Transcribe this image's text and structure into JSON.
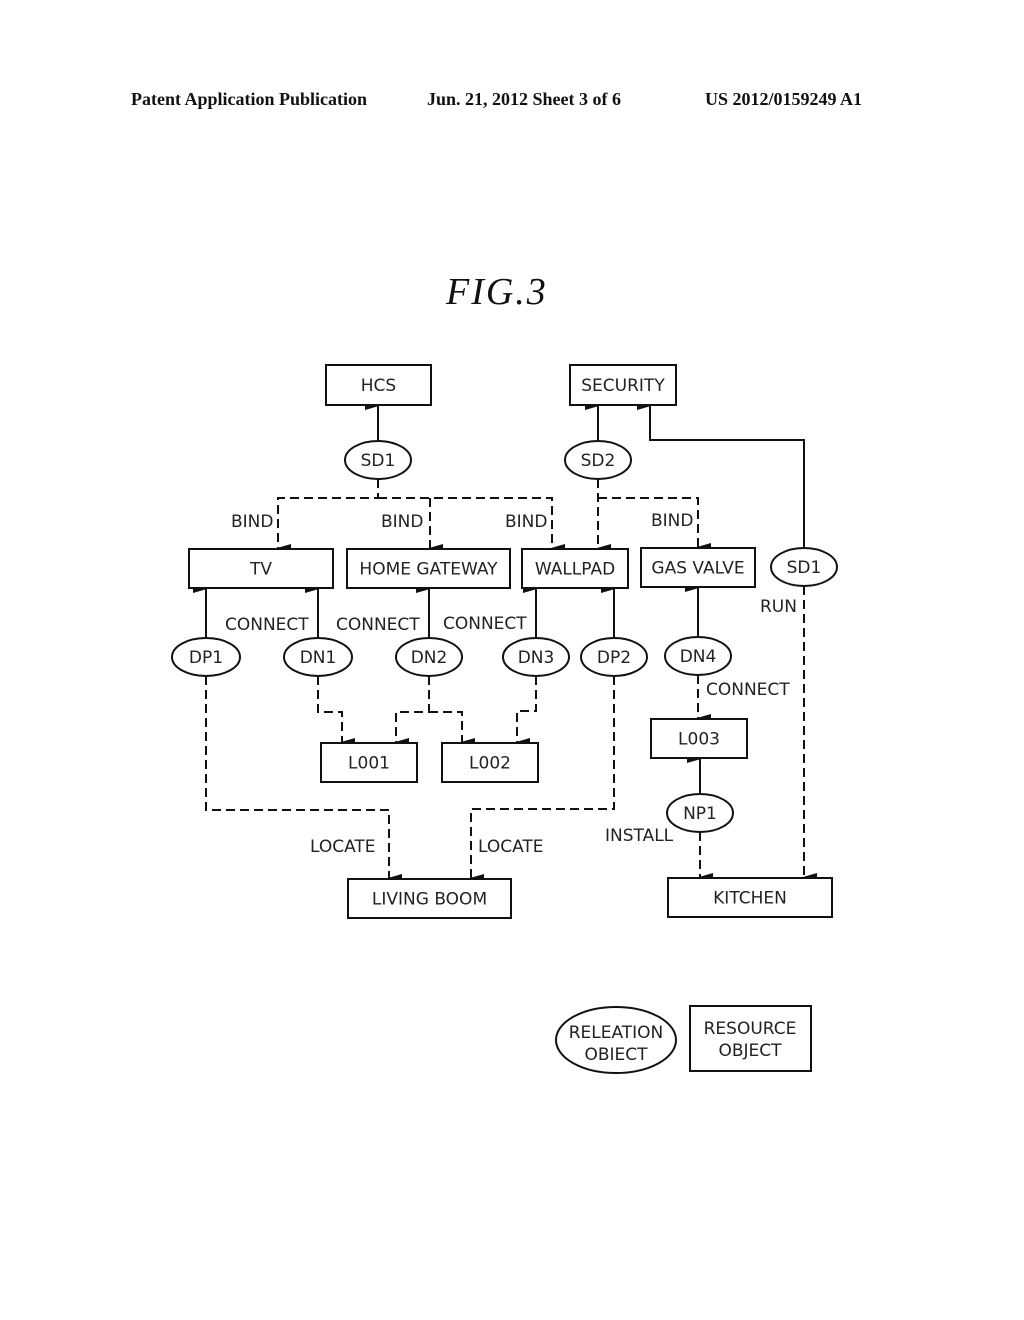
{
  "header": {
    "publication": "Patent Application Publication",
    "date_sheet": "Jun. 21, 2012  Sheet 3 of 6",
    "number": "US 2012/0159249 A1"
  },
  "figure": {
    "title": "FIG.3"
  },
  "nodes": {
    "hcs": {
      "label": "HCS",
      "kind": "resource"
    },
    "security": {
      "label": "SECURITY",
      "kind": "resource"
    },
    "sd1_top": {
      "label": "SD1",
      "kind": "relation"
    },
    "sd2": {
      "label": "SD2",
      "kind": "relation"
    },
    "tv": {
      "label": "TV",
      "kind": "resource"
    },
    "home_gateway": {
      "label": "HOME GATEWAY",
      "kind": "resource"
    },
    "wallpad": {
      "label": "WALLPAD",
      "kind": "resource"
    },
    "gas_valve": {
      "label": "GAS VALVE",
      "kind": "resource"
    },
    "sd1_right": {
      "label": "SD1",
      "kind": "relation"
    },
    "dp1": {
      "label": "DP1",
      "kind": "relation"
    },
    "dn1": {
      "label": "DN1",
      "kind": "relation"
    },
    "dn2": {
      "label": "DN2",
      "kind": "relation"
    },
    "dn3": {
      "label": "DN3",
      "kind": "relation"
    },
    "dp2": {
      "label": "DP2",
      "kind": "relation"
    },
    "dn4": {
      "label": "DN4",
      "kind": "relation"
    },
    "l001": {
      "label": "L001",
      "kind": "resource"
    },
    "l002": {
      "label": "L002",
      "kind": "resource"
    },
    "l003": {
      "label": "L003",
      "kind": "resource"
    },
    "np1": {
      "label": "NP1",
      "kind": "relation"
    },
    "living_room": {
      "label": "LIVING BOOM",
      "kind": "resource"
    },
    "kitchen": {
      "label": "KITCHEN",
      "kind": "resource"
    }
  },
  "edge_labels": {
    "bind": "BIND",
    "connect": "CONNECT",
    "locate": "LOCATE",
    "install": "INSTALL",
    "run": "RUN"
  },
  "edges": [
    {
      "from": "sd1_top",
      "to": "hcs",
      "style": "solid"
    },
    {
      "from": "sd2",
      "to": "security",
      "style": "solid"
    },
    {
      "from": "sd1_right",
      "to": "security",
      "style": "solid"
    },
    {
      "from": "sd1_top",
      "to": "tv",
      "style": "dashed",
      "label": "BIND"
    },
    {
      "from": "sd1_top",
      "to": "home_gateway",
      "style": "dashed",
      "label": "BIND"
    },
    {
      "from": "sd1_top",
      "to": "wallpad",
      "style": "dashed",
      "label": "BIND"
    },
    {
      "from": "sd2",
      "to": "wallpad",
      "style": "dashed"
    },
    {
      "from": "sd2",
      "to": "gas_valve",
      "style": "dashed",
      "label": "BIND"
    },
    {
      "from": "dp1",
      "to": "tv",
      "style": "solid"
    },
    {
      "from": "dn1",
      "to": "tv",
      "style": "solid",
      "label": "CONNECT"
    },
    {
      "from": "dn2",
      "to": "home_gateway",
      "style": "solid",
      "label": "CONNECT"
    },
    {
      "from": "dn3",
      "to": "wallpad",
      "style": "solid",
      "label": "CONNECT"
    },
    {
      "from": "dp2",
      "to": "wallpad",
      "style": "solid"
    },
    {
      "from": "dn4",
      "to": "gas_valve",
      "style": "solid"
    },
    {
      "from": "dn1",
      "to": "l001",
      "style": "dashed"
    },
    {
      "from": "dn2",
      "to": "l001",
      "style": "dashed"
    },
    {
      "from": "dn2",
      "to": "l002",
      "style": "dashed"
    },
    {
      "from": "dn3",
      "to": "l002",
      "style": "dashed"
    },
    {
      "from": "dn4",
      "to": "l003",
      "style": "dashed",
      "label": "CONNECT"
    },
    {
      "from": "np1",
      "to": "l003",
      "style": "solid"
    },
    {
      "from": "dp1",
      "to": "living_room",
      "style": "dashed",
      "label": "LOCATE"
    },
    {
      "from": "dp2",
      "to": "living_room",
      "style": "dashed",
      "label": "LOCATE"
    },
    {
      "from": "np1",
      "to": "kitchen",
      "style": "dashed",
      "label": "INSTALL"
    },
    {
      "from": "sd1_right",
      "to": "kitchen",
      "style": "dashed",
      "label": "RUN"
    }
  ],
  "legend": {
    "relation_line1": "RELEATION",
    "relation_line2": "OBIECT",
    "resource_line1": "RESOURCE",
    "resource_line2": "OBJECT"
  }
}
